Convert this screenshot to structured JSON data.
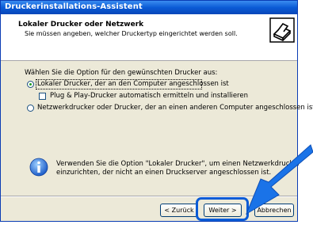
{
  "window": {
    "title": "Druckerinstallations-Assistent"
  },
  "header": {
    "title": "Lokaler Drucker oder Netzwerk",
    "subtitle": "Sie müssen angeben, welcher Druckertyp eingerichtet werden soll."
  },
  "main": {
    "prompt": "Wählen Sie die Option für den gewünschten Drucker aus:",
    "options": [
      {
        "label": "Lokaler Drucker, der an den Computer angeschlossen ist",
        "checked": true
      },
      {
        "label": "Plug & Play-Drucker automatisch ermitteln und installieren",
        "checked": false
      },
      {
        "label": "Netzwerkdrucker oder Drucker, der an einen anderen Computer angeschlossen ist",
        "checked": false
      }
    ],
    "info_line1": "Verwenden Sie die Option \"Lokaler Drucker\", um einen Netzwerkdrucker",
    "info_line2": "einzurichten, der nicht an einen Druckserver angeschlossen ist."
  },
  "buttons": {
    "back": "< Zurück",
    "next": "Weiter >",
    "cancel": "Abbrechen"
  },
  "icons": {
    "printer": "printer-icon",
    "info": "info-icon",
    "arrow": "pointer-arrow"
  },
  "colors": {
    "title_bar": "#0a5bd6",
    "highlight": "#0a5bd6",
    "arrow": "#1a73e8"
  }
}
